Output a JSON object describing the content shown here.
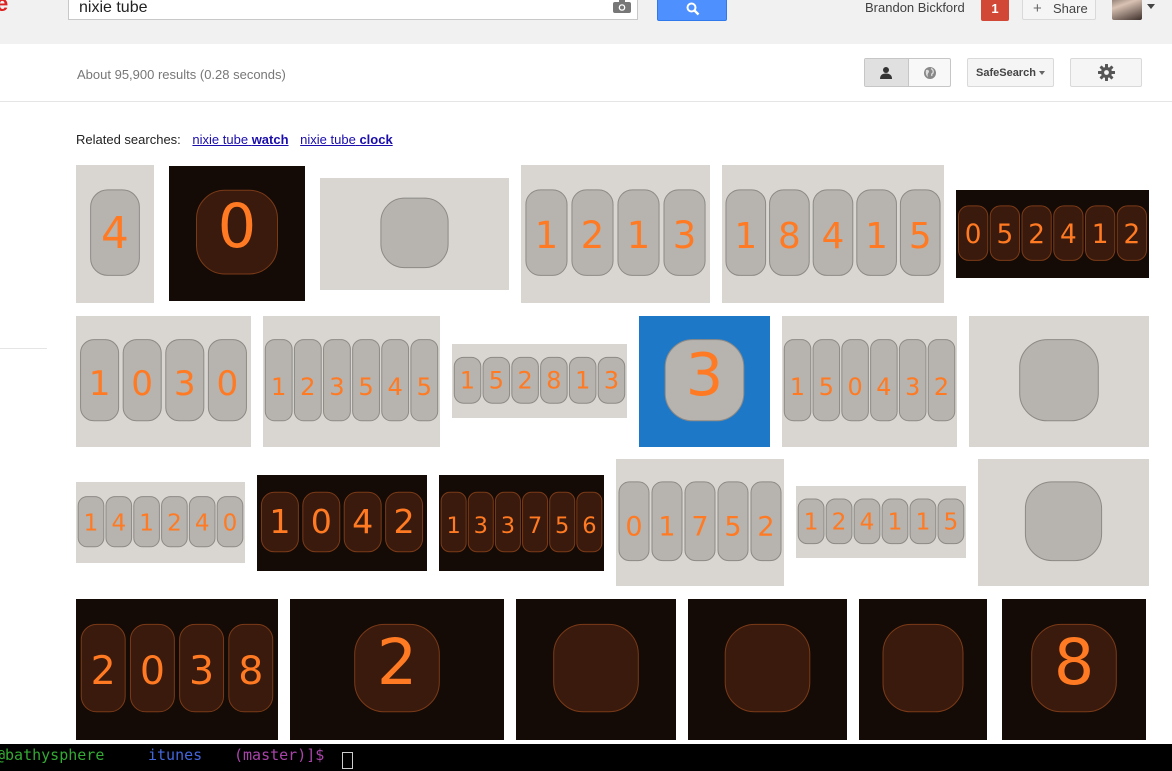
{
  "header": {
    "search_value": "nixie tube",
    "username": "Brandon Bickford",
    "notification_count": "1",
    "share_label": "Share"
  },
  "toolbar": {
    "result_stats": "About 95,900 results (0.28 seconds)",
    "safesearch_label": "SafeSearch"
  },
  "related": {
    "prefix": "Related searches:",
    "items": [
      {
        "base": "nixie tube",
        "bold": "watch"
      },
      {
        "base": "nixie tube",
        "bold": "clock"
      }
    ]
  },
  "images": [
    {
      "digits": "4",
      "theme": "light"
    },
    {
      "digits": "0",
      "theme": "dark"
    },
    {
      "digits": "",
      "theme": "light"
    },
    {
      "digits": "1213",
      "theme": "light"
    },
    {
      "digits": "18415",
      "theme": "light"
    },
    {
      "digits": "052412",
      "theme": "dark"
    },
    {
      "digits": "1030",
      "theme": "light"
    },
    {
      "digits": "123545",
      "theme": "light"
    },
    {
      "digits": "152813",
      "theme": "light"
    },
    {
      "digits": "3",
      "theme": "blue"
    },
    {
      "digits": "150432",
      "theme": "light"
    },
    {
      "digits": "",
      "theme": "light"
    },
    {
      "digits": "141240",
      "theme": "light"
    },
    {
      "digits": "1042",
      "theme": "dark"
    },
    {
      "digits": "133756",
      "theme": "dark"
    },
    {
      "digits": "01752",
      "theme": "light"
    },
    {
      "digits": "124115",
      "theme": "light"
    },
    {
      "digits": "",
      "theme": "light"
    },
    {
      "digits": "2038",
      "theme": "dark"
    },
    {
      "digits": "2",
      "theme": "dark"
    },
    {
      "digits": "",
      "theme": "dark"
    },
    {
      "digits": "",
      "theme": "dark"
    },
    {
      "digits": "",
      "theme": "dark"
    },
    {
      "digits": "8",
      "theme": "dark"
    }
  ],
  "terminal": {
    "segment1": "@bathysphere",
    "segment2": "itunes",
    "segment3": "(master)]$"
  },
  "colors": {
    "search_button": "#4d90fe",
    "badge": "#d14836",
    "link": "#1a0dab",
    "nixie_glow": "#ff7a22"
  }
}
